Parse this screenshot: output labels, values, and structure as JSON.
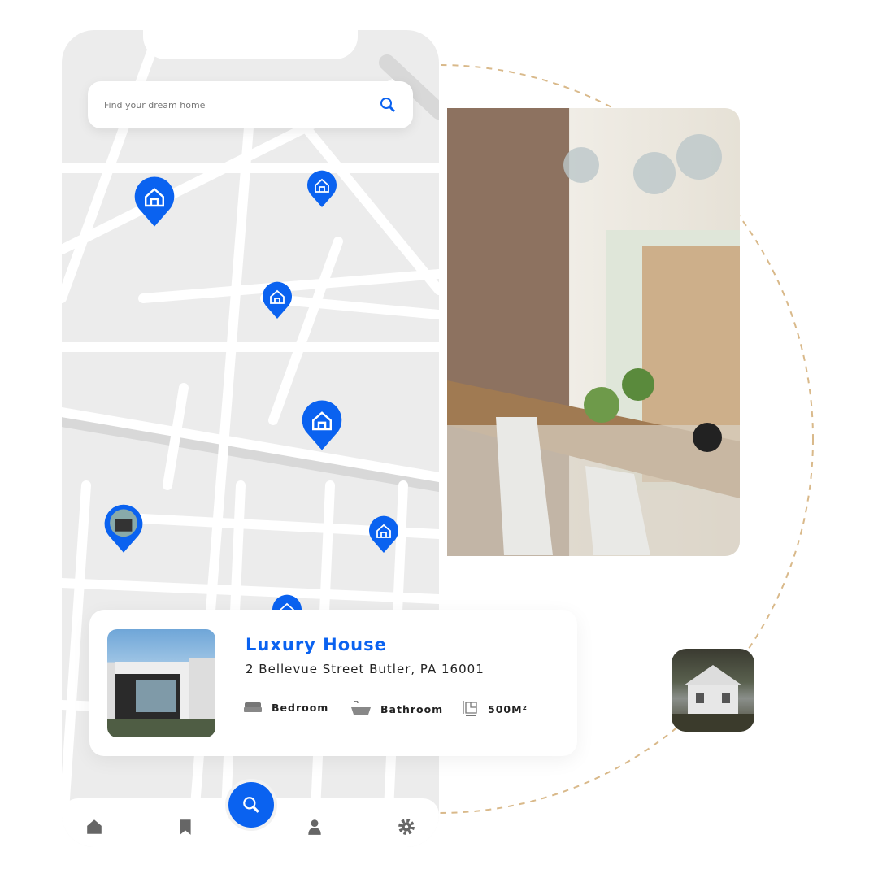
{
  "search": {
    "placeholder": "Find your dream home",
    "icon": "search-icon"
  },
  "listing": {
    "title": "Luxury House",
    "address": "2 Bellevue Street Butler, PA 16001",
    "features": [
      {
        "icon": "bed-icon",
        "label": "Bedroom"
      },
      {
        "icon": "bathtub-icon",
        "label": "Bathroom"
      },
      {
        "icon": "floorplan-icon",
        "label": "500M²"
      }
    ]
  },
  "nav": {
    "items": [
      "home-icon",
      "bookmark-icon",
      "search-icon",
      "user-icon",
      "settings-icon"
    ]
  },
  "colors": {
    "accent": "#0a62f0",
    "arc": "#d9b98a",
    "map": "#ececec"
  }
}
